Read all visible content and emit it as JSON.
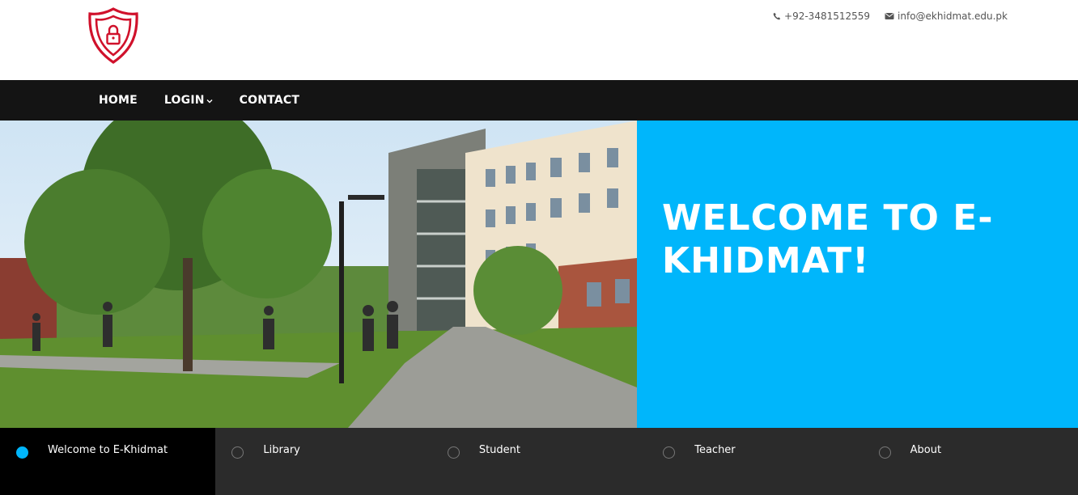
{
  "header": {
    "logo_icon": "shield-lock-icon",
    "phone": "+92-3481512559",
    "email": "info@ekhidmat.edu.pk"
  },
  "nav": {
    "items": [
      {
        "label": "HOME"
      },
      {
        "label": "LOGIN",
        "has_dropdown": true
      },
      {
        "label": "CONTACT"
      }
    ]
  },
  "hero": {
    "title": "WELCOME TO E-KHIDMAT!",
    "panel_color": "#00b6fb"
  },
  "slider_tabs": [
    {
      "label": "Welcome to E-Khidmat",
      "active": true
    },
    {
      "label": "Library",
      "active": false
    },
    {
      "label": "Student",
      "active": false
    },
    {
      "label": "Teacher",
      "active": false
    },
    {
      "label": "About",
      "active": false
    }
  ],
  "colors": {
    "accent": "#00b6fb",
    "brand_red": "#d0112b",
    "nav_bg": "#141414",
    "tabs_bg": "#2b2b2b"
  }
}
